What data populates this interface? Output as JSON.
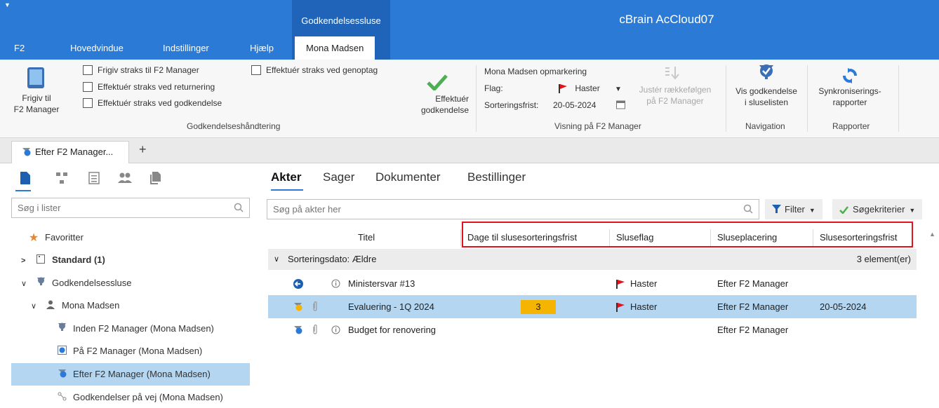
{
  "app": {
    "title": "cBrain AcCloud07",
    "context_group": "Godkendelsessluse",
    "quick_access": "▼"
  },
  "menu": {
    "items": [
      "F2",
      "Hovedvindue",
      "Indstillinger",
      "Hjælp"
    ],
    "active": "Mona Madsen"
  },
  "ribbon": {
    "frigiv_label_1": "Frigiv til",
    "frigiv_label_2": "F2 Manager",
    "checkboxes": [
      "Frigiv straks til F2 Manager",
      "Effektuér straks ved returnering",
      "Effektuér straks ved godkendelse",
      "Effektuér straks ved genoptag"
    ],
    "effektuer_1": "Effektuér",
    "effektuer_2": "godkendelse",
    "group_godkendelse": "Godkendelseshåndtering",
    "markering_title": "Mona Madsen opmarkering",
    "flag_label": "Flag:",
    "flag_value": "Haster",
    "sort_label": "Sorteringsfrist:",
    "sort_value": "20-05-2024",
    "juster_1": "Justér rækkefølgen",
    "juster_2": "på F2 Manager",
    "group_visning": "Visning på F2 Manager",
    "vis_1": "Vis godkendelse",
    "vis_2": "i sluselisten",
    "group_navigation": "Navigation",
    "synk_1": "Synkroniserings-",
    "synk_2": "rapporter",
    "group_rapporter": "Rapporter",
    "accent": "#2b7bd6",
    "check_green": "#4caf50"
  },
  "doc_tab": {
    "label": "Efter F2 Manager...",
    "add": "+"
  },
  "left": {
    "search_placeholder": "Søg i lister",
    "tree": [
      {
        "label": "Favoritter",
        "icon": "star-icon"
      },
      {
        "label": "Standard (1)",
        "icon": "list-icon",
        "chevron": ">"
      },
      {
        "label": "Godkendelsessluse",
        "icon": "approval-icon",
        "chevron": "v"
      },
      {
        "label": "Mona Madsen",
        "icon": "user-icon",
        "chevron": "v"
      },
      {
        "label": "Inden F2 Manager (Mona Madsen)",
        "icon": "approval-icon"
      },
      {
        "label": "På F2 Manager (Mona Madsen)",
        "icon": "approval-check-icon"
      },
      {
        "label": "Efter F2 Manager (Mona Madsen)",
        "icon": "approval-done-icon"
      },
      {
        "label": "Godkendelser på vej (Mona Madsen)",
        "icon": "route-icon"
      }
    ]
  },
  "right": {
    "tabs": [
      "Akter",
      "Sager",
      "Dokumenter",
      "Bestillinger"
    ],
    "search_placeholder": "Søg på akter her",
    "filter_label": "Filter",
    "criteria_label": "Søgekriterier",
    "columns": [
      "Titel",
      "Dage til slusesorteringsfrist",
      "Sluseflag",
      "Sluseplacering",
      "Slusesorteringsfrist"
    ],
    "group": {
      "label": "Sorteringsdato: Ældre",
      "count": "3 element(er)"
    },
    "rows": [
      {
        "title": "Ministersvar #13",
        "days": "",
        "flag": "Haster",
        "placement": "Efter F2 Manager",
        "deadline": ""
      },
      {
        "title": "Evaluering - 1Q 2024",
        "days": "3",
        "flag": "Haster",
        "placement": "Efter F2 Manager",
        "deadline": "20-05-2024"
      },
      {
        "title": "Budget for renovering",
        "days": "",
        "flag": "",
        "placement": "Efter F2 Manager",
        "deadline": ""
      }
    ],
    "flag_color": "#e0141e",
    "badge_color": "#f5b400"
  }
}
